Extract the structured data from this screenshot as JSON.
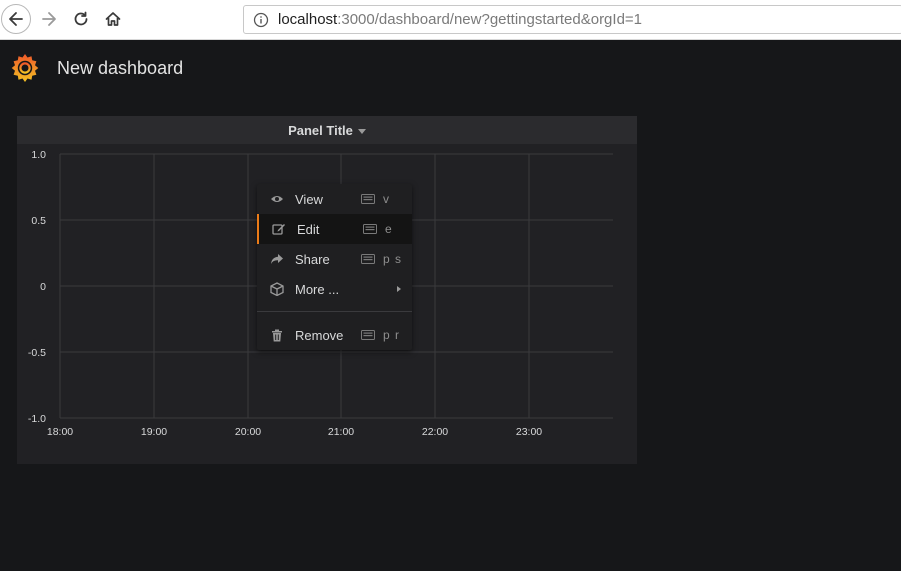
{
  "browser": {
    "url_host": "localhost",
    "url_rest": ":3000/dashboard/new?gettingstarted&orgId=1"
  },
  "header": {
    "logo_icon": "grafana-logo",
    "title": "New dashboard"
  },
  "panel": {
    "title": "Panel Title",
    "y_ticks": [
      "1.0",
      "0.5",
      "0",
      "-0.5",
      "-1.0"
    ],
    "x_ticks": [
      "18:00",
      "19:00",
      "20:00",
      "21:00",
      "22:00",
      "23:00"
    ]
  },
  "menu": {
    "items": [
      {
        "label": "View",
        "shortcut": "v",
        "icon": "eye-icon"
      },
      {
        "label": "Edit",
        "shortcut": "e",
        "icon": "edit-icon"
      },
      {
        "label": "Share",
        "shortcut": "p s",
        "icon": "share-icon"
      },
      {
        "label": "More ...",
        "shortcut": "",
        "icon": "cube-icon"
      },
      {
        "label": "Remove",
        "shortcut": "p r",
        "icon": "trash-icon"
      }
    ]
  },
  "colors": {
    "background": "#161719",
    "panel": "#212124",
    "accent": "#eb7b18",
    "text": "#d8d9da"
  }
}
